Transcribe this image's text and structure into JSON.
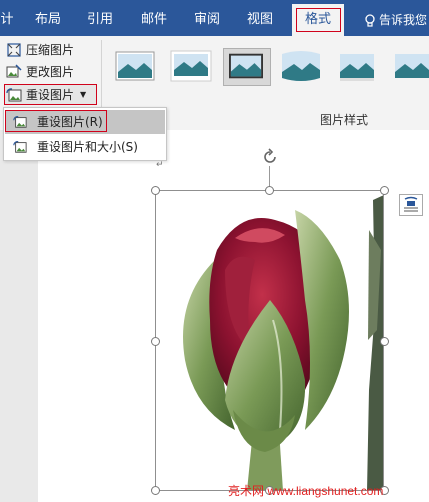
{
  "tabs": [
    {
      "label": "计"
    },
    {
      "label": "布局"
    },
    {
      "label": "引用"
    },
    {
      "label": "邮件"
    },
    {
      "label": "审阅"
    },
    {
      "label": "视图"
    },
    {
      "label": "格式"
    }
  ],
  "tell_me": "告诉我您",
  "adjust": {
    "compress": "压缩图片",
    "change": "更改图片",
    "reset": "重设图片"
  },
  "styles_group_label": "图片样式",
  "menu": {
    "reset_picture": "重设图片(R)",
    "reset_picture_size": "重设图片和大小(S)"
  },
  "watermark": "亮术网 www.liangshunet.com",
  "colors": {
    "ribbon_blue": "#2b579a",
    "highlight_red": "#d0021b"
  }
}
